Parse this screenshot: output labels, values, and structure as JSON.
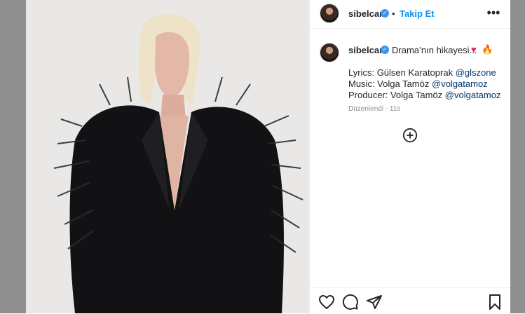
{
  "header": {
    "username": "sibelcan",
    "separator": "•",
    "follow_label": "Takip Et",
    "more_label": "•••"
  },
  "caption": {
    "username": "sibelcan",
    "text": "Drama’nın hikayesi...",
    "emojis": [
      "♥",
      "🔥"
    ],
    "credits": [
      {
        "label": "Lyrics: Gülsen Karatoprak",
        "mention": "@glszone"
      },
      {
        "label": "Music: Volga Tamöz",
        "mention": "@volgatamoz"
      },
      {
        "label": "Producer: Volga Tamöz",
        "mention": "@volgatamoz"
      }
    ],
    "edited": "Düzenlendi · 11s"
  },
  "carousel": {
    "next_label": "›"
  },
  "icons": {
    "verified": "verified-badge-icon",
    "add_comment": "add-circle-icon",
    "like": "heart-icon",
    "comment": "comment-bubble-icon",
    "share": "paper-plane-icon",
    "save": "bookmark-icon",
    "next": "chevron-right-icon"
  },
  "colors": {
    "accent": "#0095f6",
    "verified": "#3897f0",
    "mention": "#00376b",
    "muted": "#8e8e8e"
  }
}
